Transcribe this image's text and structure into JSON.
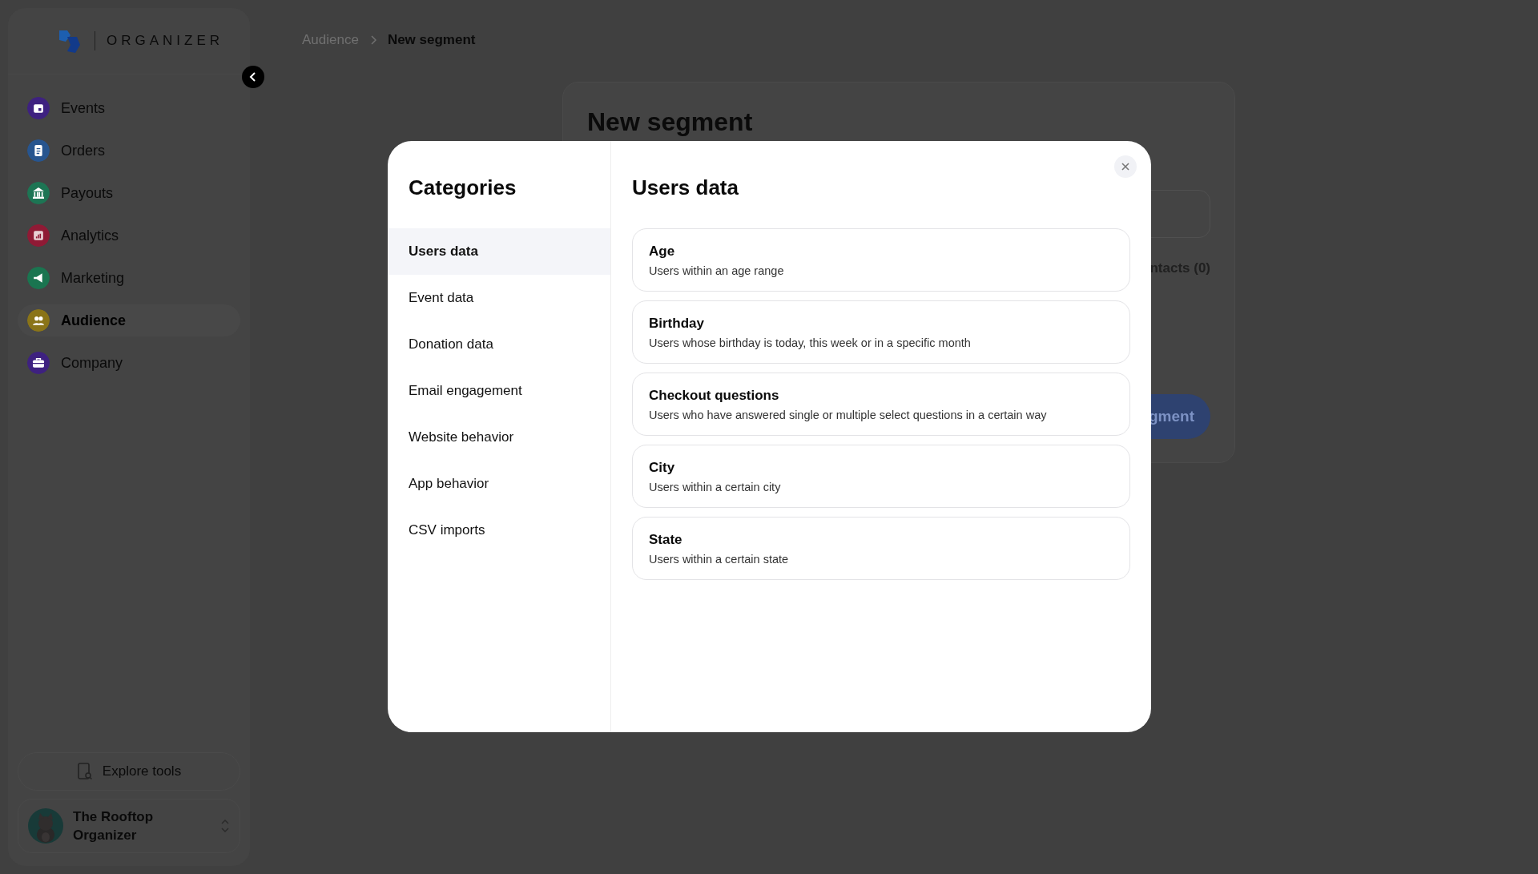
{
  "sidebar": {
    "logo_text": "ORGANIZER",
    "nav_items": [
      {
        "label": "Events",
        "color": "#3e2180",
        "selected": false
      },
      {
        "label": "Orders",
        "color": "#27558f",
        "selected": false
      },
      {
        "label": "Payouts",
        "color": "#1d7554",
        "selected": false
      },
      {
        "label": "Analytics",
        "color": "#8f1a35",
        "selected": false
      },
      {
        "label": "Marketing",
        "color": "#1a7550",
        "selected": false
      },
      {
        "label": "Audience",
        "color": "#8a7418",
        "selected": true
      },
      {
        "label": "Company",
        "color": "#3e2180",
        "selected": false
      }
    ],
    "explore_button": "Explore tools",
    "profile": {
      "name": "The Rooftop Organizer"
    }
  },
  "breadcrumb": [
    {
      "label": "Audience",
      "current": false
    },
    {
      "label": "New segment",
      "current": true
    }
  ],
  "segment_card": {
    "title": "New segment",
    "contacts_fragment": "ntacts (0)",
    "button_fragment": "gment"
  },
  "modal": {
    "categories_title": "Categories",
    "categories": [
      {
        "label": "Users data",
        "selected": true
      },
      {
        "label": "Event data",
        "selected": false
      },
      {
        "label": "Donation data",
        "selected": false
      },
      {
        "label": "Email engagement",
        "selected": false
      },
      {
        "label": "Website behavior",
        "selected": false
      },
      {
        "label": "App behavior",
        "selected": false
      },
      {
        "label": "CSV imports",
        "selected": false
      }
    ],
    "section_title": "Users data",
    "options": [
      {
        "title": "Age",
        "description": "Users within an age range"
      },
      {
        "title": "Birthday",
        "description": "Users whose birthday is today, this week or in a specific month"
      },
      {
        "title": "Checkout questions",
        "description": "Users who have answered single or multiple select questions in a certain way"
      },
      {
        "title": "City",
        "description": "Users within a certain city"
      },
      {
        "title": "State",
        "description": "Users within a certain state"
      }
    ]
  }
}
